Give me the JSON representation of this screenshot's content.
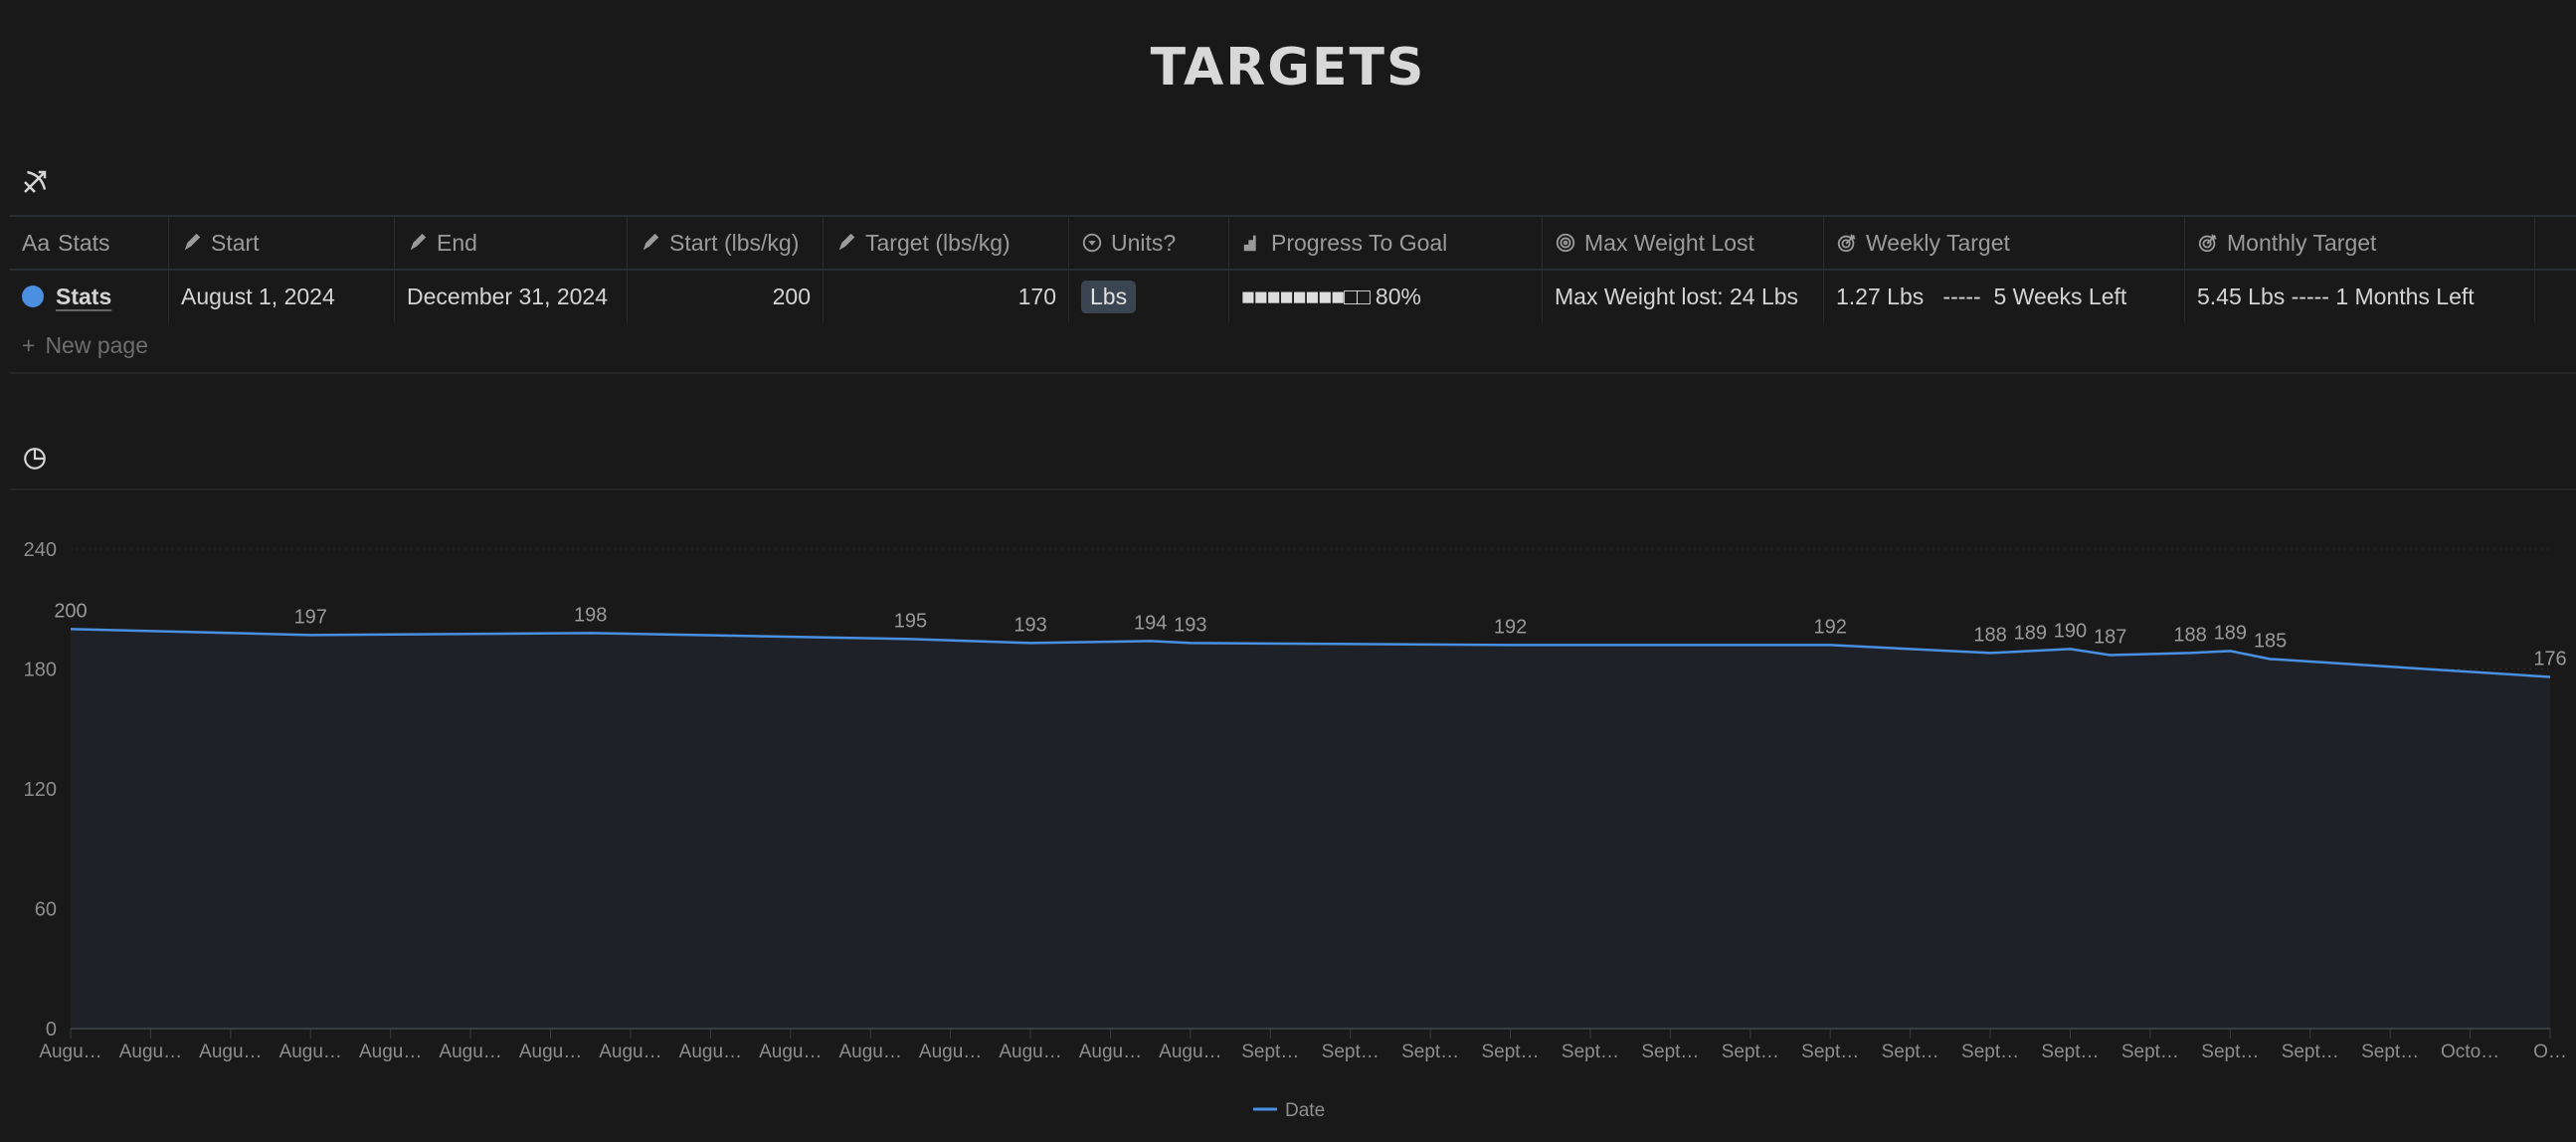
{
  "page": {
    "title": "TARGETS",
    "db_icon": "bow-arrow-icon",
    "chart_icon": "pie-chart-icon"
  },
  "table": {
    "headers": [
      {
        "label": "Stats",
        "icon": "Aa"
      },
      {
        "label": "Start",
        "icon": "pencil-icon"
      },
      {
        "label": "End",
        "icon": "pencil-icon"
      },
      {
        "label": "Start (lbs/kg)",
        "icon": "pencil-icon"
      },
      {
        "label": "Target (lbs/kg)",
        "icon": "pencil-icon"
      },
      {
        "label": "Units?",
        "icon": "select-icon"
      },
      {
        "label": "Progress To Goal",
        "icon": "rollup-icon"
      },
      {
        "label": "Max Weight Lost",
        "icon": "target-icon"
      },
      {
        "label": "Weekly Target",
        "icon": "target-arrow-icon"
      },
      {
        "label": "Monthly Target",
        "icon": "target-arrow-icon"
      }
    ],
    "rows": [
      {
        "name": "Stats",
        "start": "August 1, 2024",
        "end": "December 31, 2024",
        "start_weight": "200",
        "target_weight": "170",
        "units": "Lbs",
        "progress_bar": "■■■■■■■■□□",
        "progress": "80%",
        "progress_fraction": 0.8,
        "max_weight_lost": "Max Weight lost: 24 Lbs",
        "weekly_target": "1.27 Lbs   -----  5 Weeks Left",
        "monthly_target": "5.45 Lbs ----- 1 Months Left"
      }
    ],
    "new_page": "New page",
    "accent": "#4a8fe0"
  },
  "chart_data": {
    "type": "area",
    "legend": [
      "Date"
    ],
    "legend_placement": "bottom",
    "ylim": [
      0,
      240
    ],
    "y_ticks": [
      "0",
      "60",
      "120",
      "180",
      "240"
    ],
    "grid": true,
    "line_color": "#4a90e2",
    "x_tick_labels": [
      "Augu…",
      "Augu…",
      "Augu…",
      "Augu…",
      "Augu…",
      "Augu…",
      "Augu…",
      "Augu…",
      "Augu…",
      "Augu…",
      "Augu…",
      "Augu…",
      "Augu…",
      "Augu…",
      "Augu…",
      "Sept…",
      "Sept…",
      "Sept…",
      "Sept…",
      "Sept…",
      "Sept…",
      "Sept…",
      "Sept…",
      "Sept…",
      "Sept…",
      "Sept…",
      "Sept…",
      "Sept…",
      "Sept…",
      "Sept…",
      "Octo…",
      "O…"
    ],
    "category_count": 63,
    "points": [
      {
        "i": 0,
        "value": 200
      },
      {
        "i": 6,
        "value": 197
      },
      {
        "i": 13,
        "value": 198
      },
      {
        "i": 21,
        "value": 195
      },
      {
        "i": 24,
        "value": 193
      },
      {
        "i": 27,
        "value": 194
      },
      {
        "i": 28,
        "value": 193
      },
      {
        "i": 36,
        "value": 192
      },
      {
        "i": 44,
        "value": 192
      },
      {
        "i": 48,
        "value": 188
      },
      {
        "i": 49,
        "value": 189
      },
      {
        "i": 50,
        "value": 190
      },
      {
        "i": 51,
        "value": 187
      },
      {
        "i": 53,
        "value": 188
      },
      {
        "i": 54,
        "value": 189
      },
      {
        "i": 55,
        "value": 185
      },
      {
        "i": 62,
        "value": 176
      }
    ]
  }
}
